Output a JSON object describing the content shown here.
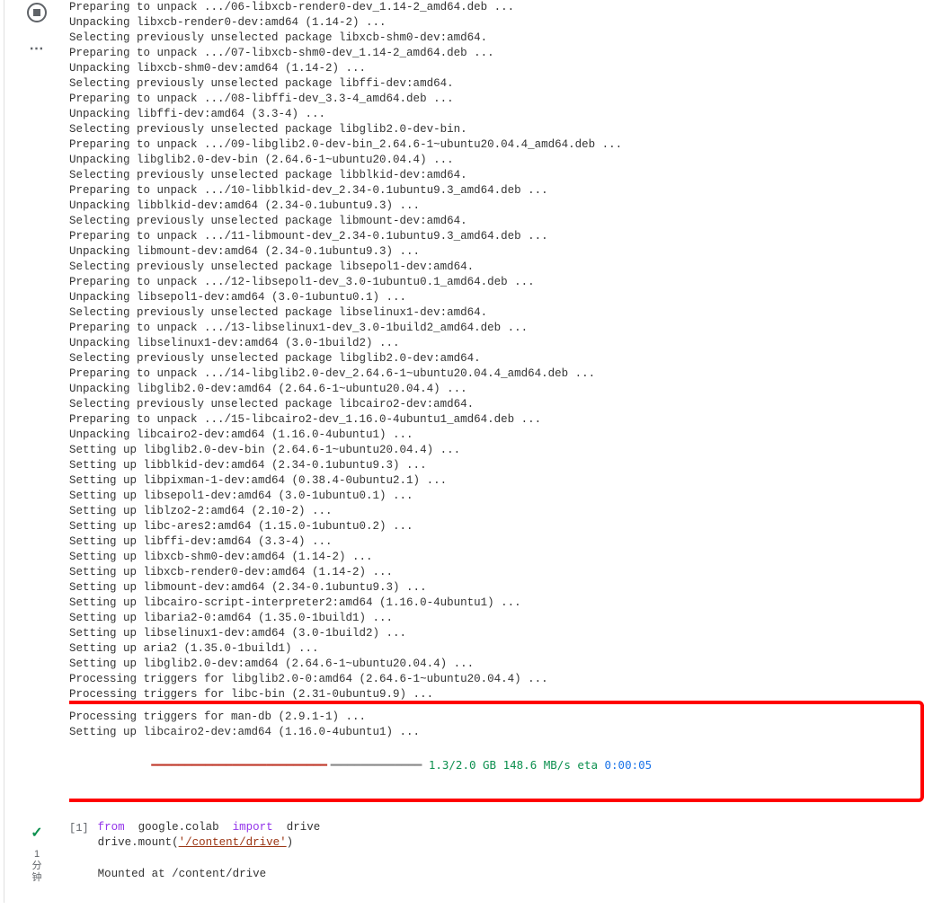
{
  "cell1": {
    "output_lines": [
      "Preparing to unpack .../06-libxcb-render0-dev_1.14-2_amd64.deb ...",
      "Unpacking libxcb-render0-dev:amd64 (1.14-2) ...",
      "Selecting previously unselected package libxcb-shm0-dev:amd64.",
      "Preparing to unpack .../07-libxcb-shm0-dev_1.14-2_amd64.deb ...",
      "Unpacking libxcb-shm0-dev:amd64 (1.14-2) ...",
      "Selecting previously unselected package libffi-dev:amd64.",
      "Preparing to unpack .../08-libffi-dev_3.3-4_amd64.deb ...",
      "Unpacking libffi-dev:amd64 (3.3-4) ...",
      "Selecting previously unselected package libglib2.0-dev-bin.",
      "Preparing to unpack .../09-libglib2.0-dev-bin_2.64.6-1~ubuntu20.04.4_amd64.deb ...",
      "Unpacking libglib2.0-dev-bin (2.64.6-1~ubuntu20.04.4) ...",
      "Selecting previously unselected package libblkid-dev:amd64.",
      "Preparing to unpack .../10-libblkid-dev_2.34-0.1ubuntu9.3_amd64.deb ...",
      "Unpacking libblkid-dev:amd64 (2.34-0.1ubuntu9.3) ...",
      "Selecting previously unselected package libmount-dev:amd64.",
      "Preparing to unpack .../11-libmount-dev_2.34-0.1ubuntu9.3_amd64.deb ...",
      "Unpacking libmount-dev:amd64 (2.34-0.1ubuntu9.3) ...",
      "Selecting previously unselected package libsepol1-dev:amd64.",
      "Preparing to unpack .../12-libsepol1-dev_3.0-1ubuntu0.1_amd64.deb ...",
      "Unpacking libsepol1-dev:amd64 (3.0-1ubuntu0.1) ...",
      "Selecting previously unselected package libselinux1-dev:amd64.",
      "Preparing to unpack .../13-libselinux1-dev_3.0-1build2_amd64.deb ...",
      "Unpacking libselinux1-dev:amd64 (3.0-1build2) ...",
      "Selecting previously unselected package libglib2.0-dev:amd64.",
      "Preparing to unpack .../14-libglib2.0-dev_2.64.6-1~ubuntu20.04.4_amd64.deb ...",
      "Unpacking libglib2.0-dev:amd64 (2.64.6-1~ubuntu20.04.4) ...",
      "Selecting previously unselected package libcairo2-dev:amd64.",
      "Preparing to unpack .../15-libcairo2-dev_1.16.0-4ubuntu1_amd64.deb ...",
      "Unpacking libcairo2-dev:amd64 (1.16.0-4ubuntu1) ...",
      "Setting up libglib2.0-dev-bin (2.64.6-1~ubuntu20.04.4) ...",
      "Setting up libblkid-dev:amd64 (2.34-0.1ubuntu9.3) ...",
      "Setting up libpixman-1-dev:amd64 (0.38.4-0ubuntu2.1) ...",
      "Setting up libsepol1-dev:amd64 (3.0-1ubuntu0.1) ...",
      "Setting up liblzo2-2:amd64 (2.10-2) ...",
      "Setting up libc-ares2:amd64 (1.15.0-1ubuntu0.2) ...",
      "Setting up libffi-dev:amd64 (3.3-4) ...",
      "Setting up libxcb-shm0-dev:amd64 (1.14-2) ...",
      "Setting up libxcb-render0-dev:amd64 (1.14-2) ...",
      "Setting up libmount-dev:amd64 (2.34-0.1ubuntu9.3) ...",
      "Setting up libcairo-script-interpreter2:amd64 (1.16.0-4ubuntu1) ...",
      "Setting up libaria2-0:amd64 (1.35.0-1build1) ...",
      "Setting up libselinux1-dev:amd64 (3.0-1build2) ...",
      "Setting up aria2 (1.35.0-1build1) ...",
      "Setting up libglib2.0-dev:amd64 (2.64.6-1~ubuntu20.04.4) ...",
      "Processing triggers for libglib2.0-0:amd64 (2.64.6-1~ubuntu20.04.4) ...",
      "Processing triggers for libc-bin (2.31-0ubuntu9.9) ..."
    ],
    "highlight_lines": [
      "Processing triggers for man-db (2.9.1-1) ...",
      "Setting up libcairo2-dev:amd64 (1.16.0-4ubuntu1) ..."
    ],
    "progress": {
      "bar_done": "━━━━━━━━━━━━━━━━━━━━━━━━━━",
      "bar_remain": "╺━━━━━━━━━━━━━",
      "stats": " 1.3/2.0 GB 148.6 MB/s eta ",
      "eta": "0:00:05"
    }
  },
  "cell2": {
    "number": "[1]",
    "timing_line1": "1",
    "timing_line2": "分",
    "timing_line3": "钟",
    "code": {
      "kw1": "from",
      "module": "google.colab",
      "kw2": "import",
      "name": "drive",
      "line2_pre": "drive.mount(",
      "line2_path": "'/content/drive'",
      "line2_post": ")"
    },
    "output": "Mounted at /content/drive"
  }
}
